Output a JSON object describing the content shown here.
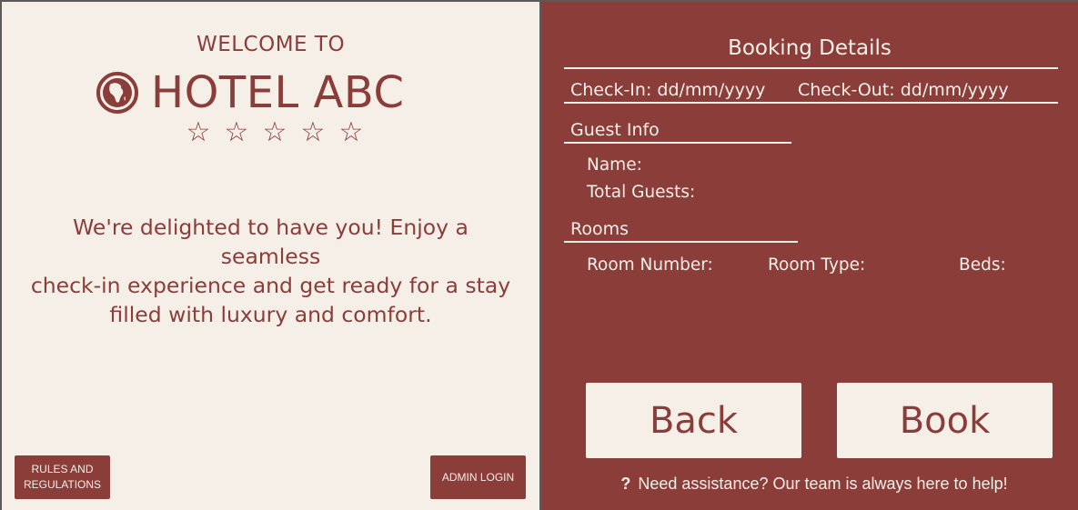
{
  "left": {
    "welcome": "WELCOME TO",
    "hotel_name": "HOTEL ABC",
    "stars": [
      "☆",
      "☆",
      "☆",
      "☆",
      "☆"
    ],
    "tagline_lines": [
      "We're delighted to have you! Enjoy a seamless",
      "check-in experience and get ready for a stay",
      "filled with luxury and comfort."
    ],
    "rules_button": [
      "RULES AND",
      "REGULATIONS"
    ],
    "admin_button": "ADMIN LOGIN",
    "logo_icon": "globe-africa-icon"
  },
  "right": {
    "title": "Booking Details",
    "check_in": "Check-In: dd/mm/yyyy",
    "check_out": "Check-Out: dd/mm/yyyy",
    "guest_info_heading": "Guest Info",
    "name_label": "Name:",
    "total_guests_label": "Total Guests:",
    "rooms_heading": "Rooms",
    "room_number_label": "Room Number:",
    "room_type_label": "Room Type:",
    "beds_label": "Beds:",
    "back_button": "Back",
    "book_button": "Book",
    "assist_icon": "?",
    "assist_text": "Need assistance? Our team is always here to help!"
  },
  "colors": {
    "cream": "#f5efe8",
    "maroon": "#8a3d39"
  }
}
